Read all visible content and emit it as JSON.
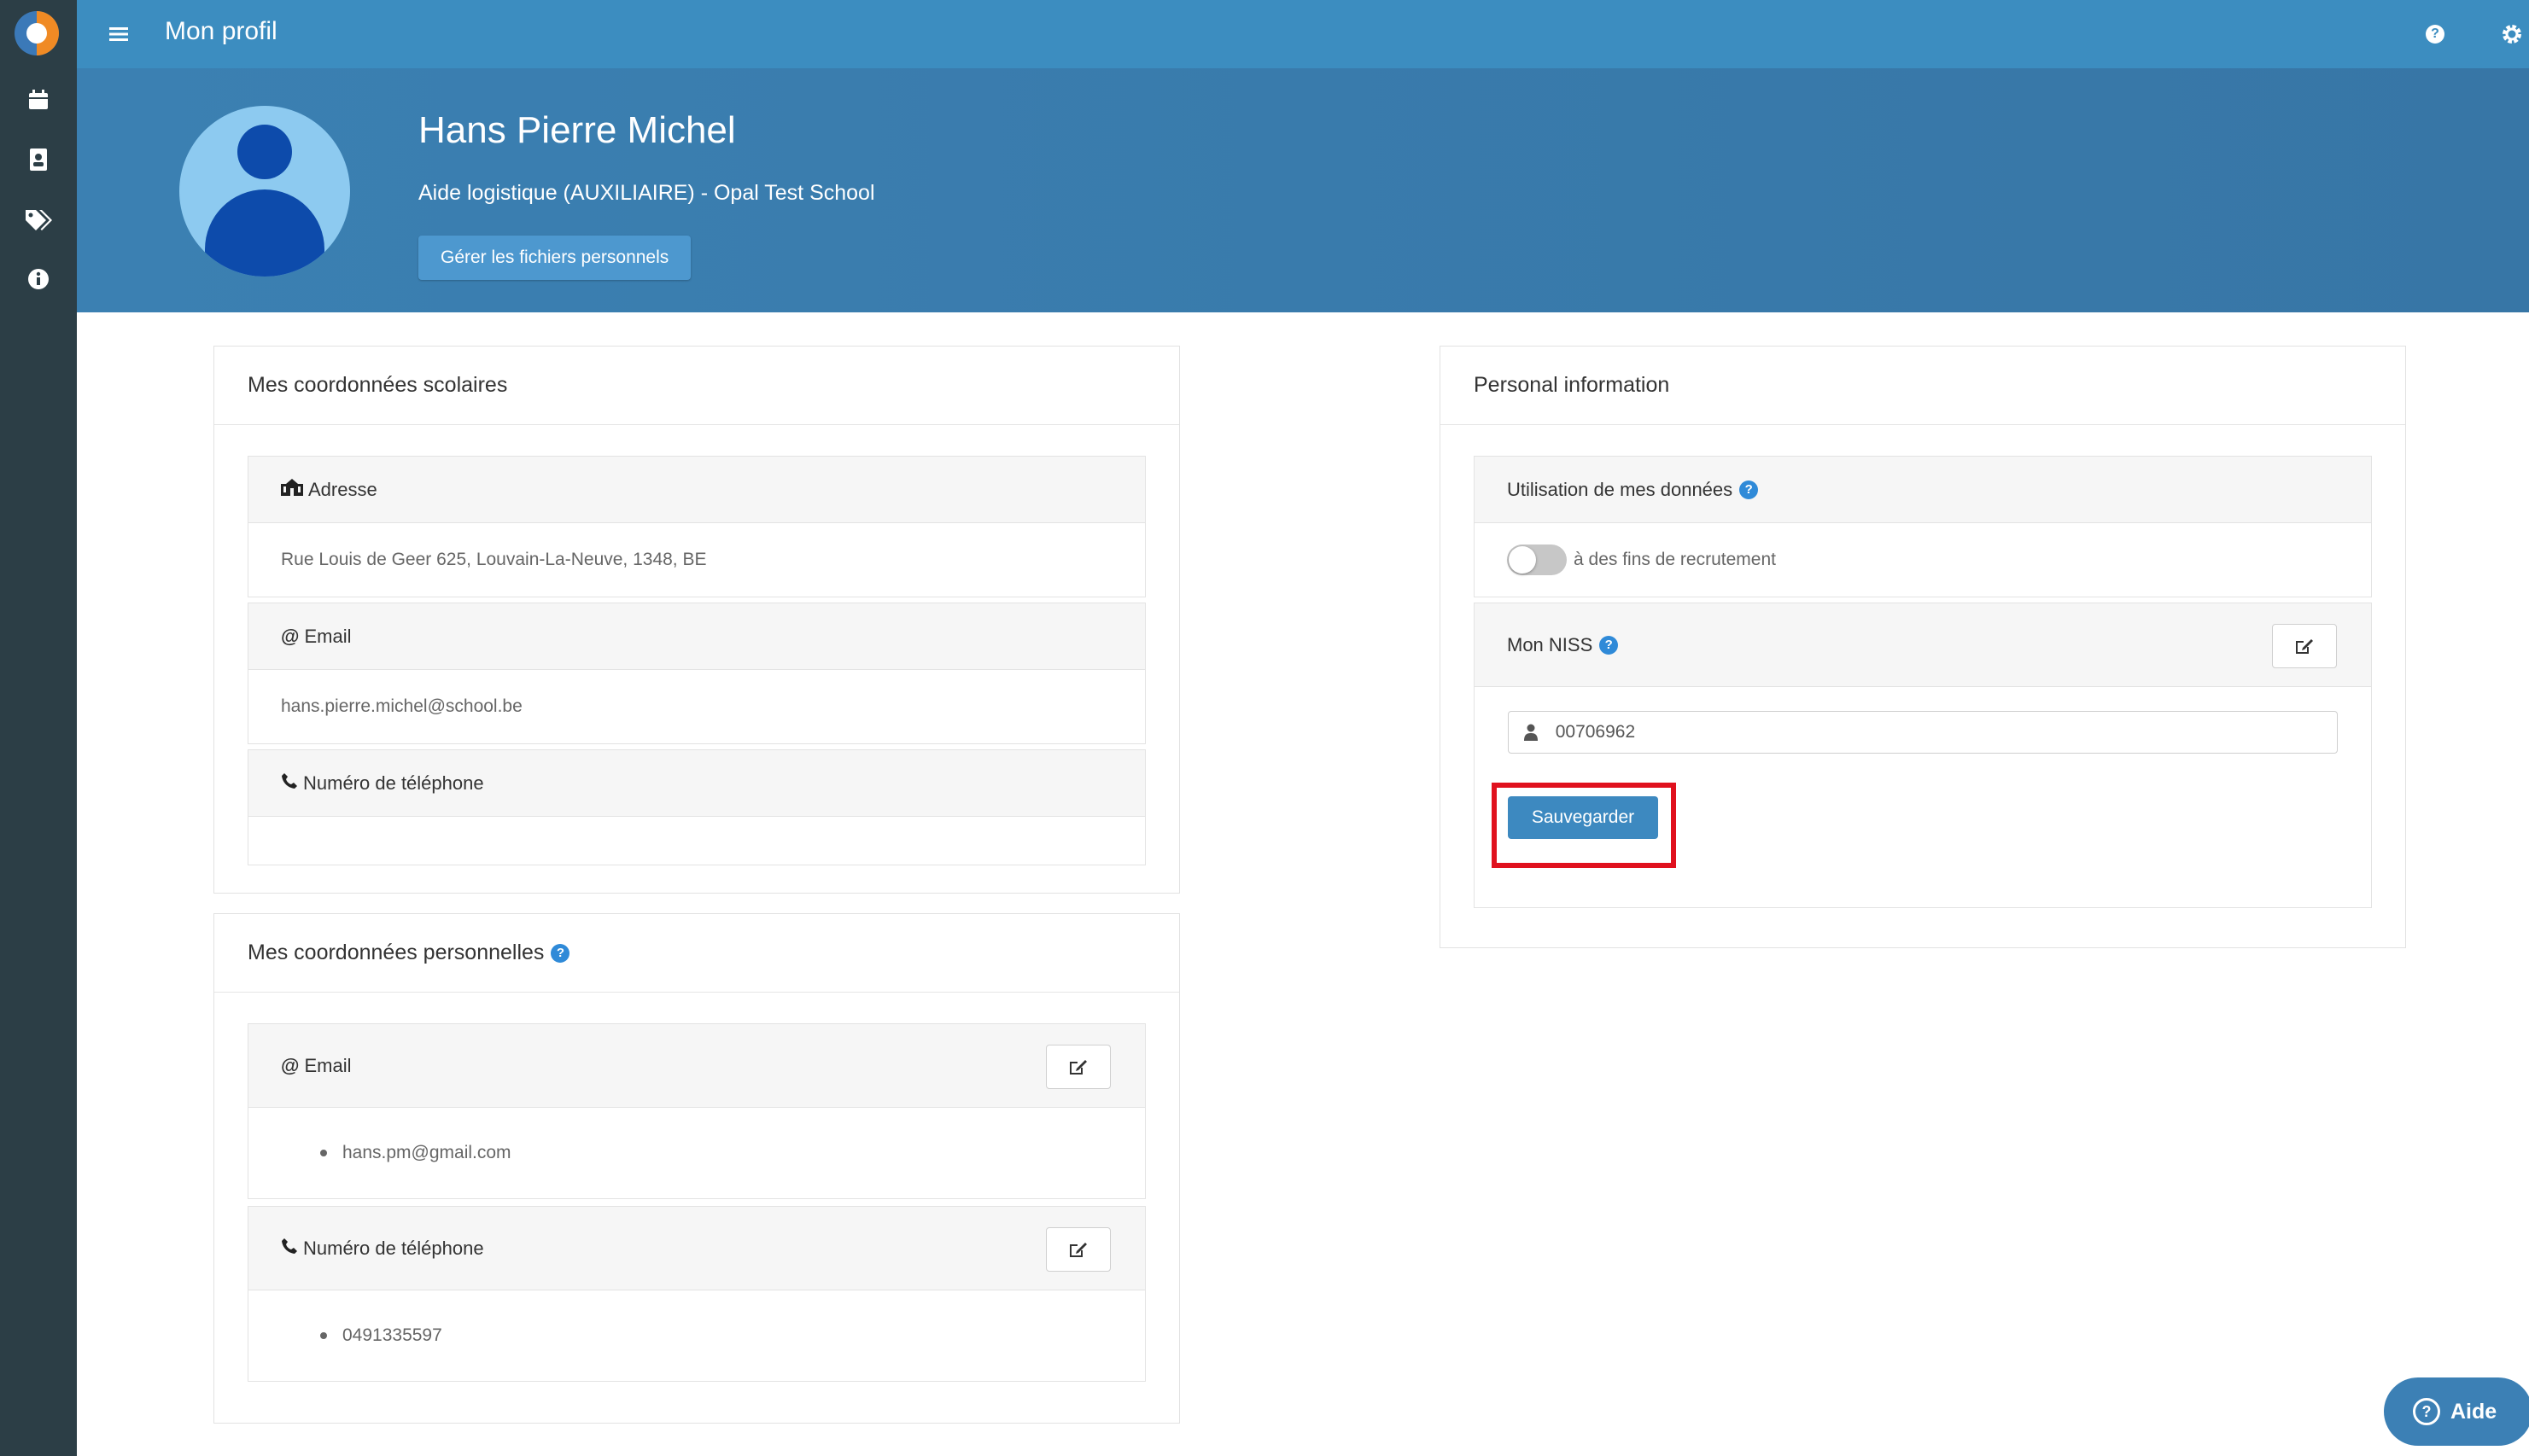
{
  "topbar": {
    "title": "Mon profil"
  },
  "sidebar": {
    "items": [
      {
        "icon": "calendar-icon"
      },
      {
        "icon": "contact-card-icon"
      },
      {
        "icon": "tags-icon"
      },
      {
        "icon": "info-icon"
      }
    ]
  },
  "profile": {
    "name": "Hans Pierre Michel",
    "subtitle": "Aide logistique (AUXILIAIRE) - Opal Test School",
    "files_button": "Gérer les fichiers personnels"
  },
  "school_contact": {
    "title": "Mes coordonnées scolaires",
    "address_label": "Adresse",
    "address_value": "Rue Louis de Geer 625, Louvain-La-Neuve, 1348, BE",
    "email_label": "Email",
    "email_value": "hans.pierre.michel@school.be",
    "phone_label": "Numéro de téléphone",
    "phone_value": ""
  },
  "personal_contact": {
    "title": "Mes coordonnées personnelles",
    "email_label": "Email",
    "emails": [
      "hans.pm@gmail.com"
    ],
    "phone_label": "Numéro de téléphone",
    "phones": [
      "0491335597"
    ]
  },
  "personal_info": {
    "title": "Personal information",
    "data_usage_label": "Utilisation de mes données",
    "recruitment_toggle_label": "à des fins de recrutement",
    "recruitment_toggle_on": false,
    "niss_label": "Mon NISS",
    "niss_value": "00706962",
    "save_button": "Sauvegarder"
  },
  "help_button": "Aide",
  "colors": {
    "topbar": "#3c8dc0",
    "sidebar": "#2c3e46",
    "banner": "#3b80b2",
    "highlight": "#e0111e"
  }
}
